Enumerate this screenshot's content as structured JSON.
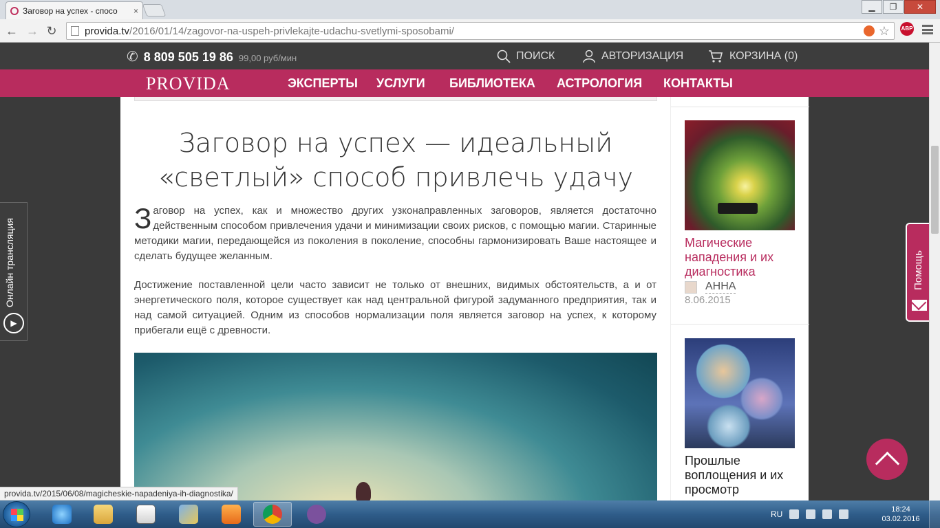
{
  "browser": {
    "tab_title": "Заговор на успех - спосо",
    "tab_close": "×",
    "url_host": "provida.tv",
    "url_path": "/2016/01/14/zagovor-na-uspeh-privlekajte-udachu-svetlymi-sposobami/",
    "abp_label": "ABP",
    "status_url": "provida.tv/2015/06/08/magicheskie-napadeniya-ih-diagnostika/"
  },
  "topbar": {
    "phone": "8 809 505 19 86",
    "price": "99,00 руб/мин",
    "search": "ПОИСК",
    "auth": "АВТОРИЗАЦИЯ",
    "cart": "КОРЗИНА (0)"
  },
  "nav": {
    "logo": "PROVIDA",
    "items": [
      "ЭКСПЕРТЫ",
      "УСЛУГИ",
      "БИБЛИОТЕКА",
      "АСТРОЛОГИЯ",
      "КОНТАКТЫ"
    ]
  },
  "article": {
    "title": "Заговор на успех — идеальный «светлый» способ привлечь удачу",
    "dropcap": "З",
    "p1": "аговор на успех, как и множество других узконаправленных заговоров, является достаточно действенным способом привлечения удачи и минимизации своих рисков, с помощью магии. Старинные методики магии, передающейся из поколения в поколение, способны гармонизировать Ваше настоящее и сделать будущее желанным.",
    "p2": "Достижение поставленной цели часто зависит не только от внешних, видимых обстоятельств, а и от энергетического поля, которое существует как над центральной фигурой задуманного предприятия, так и над самой ситуацией. Одним из способов нормализации поля является заговор на успех, к которому прибегали ещё с древности."
  },
  "sidebar": {
    "cards": [
      {
        "title": "Магические нападения и их диагностика",
        "author": "АННА",
        "date": "8.06.2015"
      },
      {
        "title": "Прошлые воплощения и их просмотр"
      }
    ]
  },
  "floating": {
    "live": "Онлайн трансляция",
    "help": "Помощь"
  },
  "taskbar": {
    "lang": "RU",
    "time": "18:24",
    "date": "03.02.2016"
  },
  "colors": {
    "brand": "#b82c5e",
    "topbar": "#3d3d3d"
  }
}
